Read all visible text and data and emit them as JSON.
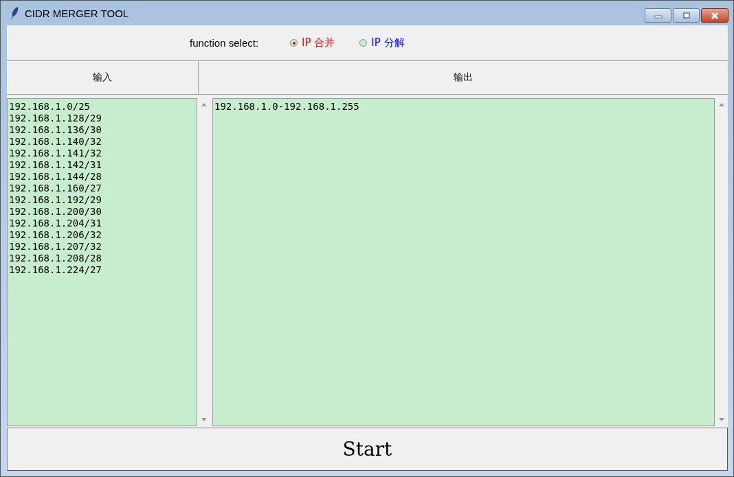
{
  "window": {
    "title": "CIDR MERGER TOOL"
  },
  "function_select": {
    "label": "function select:",
    "options": [
      {
        "label": "IP 合并",
        "selected": true,
        "color": "#ff0000"
      },
      {
        "label": "IP 分解",
        "selected": false,
        "color": "#0000ff"
      }
    ]
  },
  "columns": [
    {
      "header": "输入",
      "lines": [
        "192.168.1.0/25",
        "192.168.1.128/29",
        "192.168.1.136/30",
        "192.168.1.140/32",
        "192.168.1.141/32",
        "192.168.1.142/31",
        "192.168.1.144/28",
        "192.168.1.160/27",
        "192.168.1.192/29",
        "192.168.1.200/30",
        "192.168.1.204/31",
        "192.168.1.206/32",
        "192.168.1.207/32",
        "192.168.1.208/28",
        "192.168.1.224/27"
      ]
    },
    {
      "header": "输出",
      "lines": [
        "192.168.1.0-192.168.1.255"
      ]
    }
  ],
  "start_button": "Start"
}
